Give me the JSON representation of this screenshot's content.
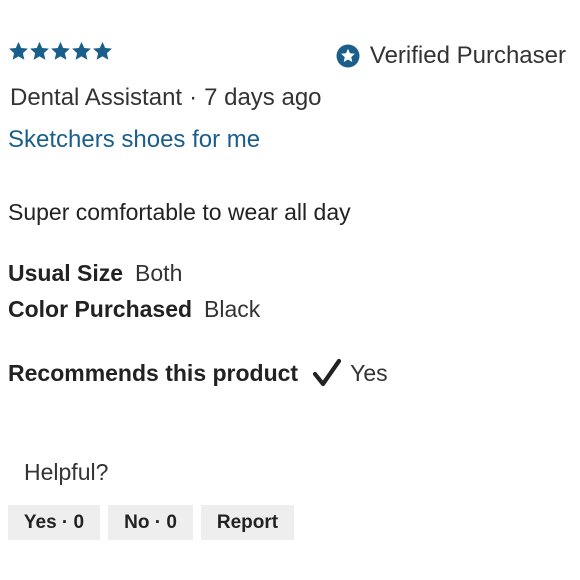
{
  "rating": {
    "stars": 5,
    "max": 5,
    "color": "#1a5e8c"
  },
  "verified": {
    "label": "Verified Purchaser",
    "icon": "star-badge-icon",
    "color": "#1a5e8c"
  },
  "reviewer": {
    "name": "Dental Assistant",
    "separator": "·",
    "time_ago": "7 days ago"
  },
  "review": {
    "title": "Sketchers shoes for me",
    "body": "Super comfortable to wear all day"
  },
  "attributes": {
    "usual_size": {
      "label": "Usual Size",
      "value": "Both"
    },
    "color_purchased": {
      "label": "Color Purchased",
      "value": "Black"
    }
  },
  "recommends": {
    "label": "Recommends this product",
    "icon": "checkmark-icon",
    "value": "Yes"
  },
  "helpful": {
    "prompt": "Helpful?",
    "yes_label": "Yes · 0",
    "no_label": "No · 0",
    "report_label": "Report"
  },
  "colors": {
    "accent": "#1a5e8c",
    "text": "#222222",
    "button_bg": "#eeeeee"
  }
}
